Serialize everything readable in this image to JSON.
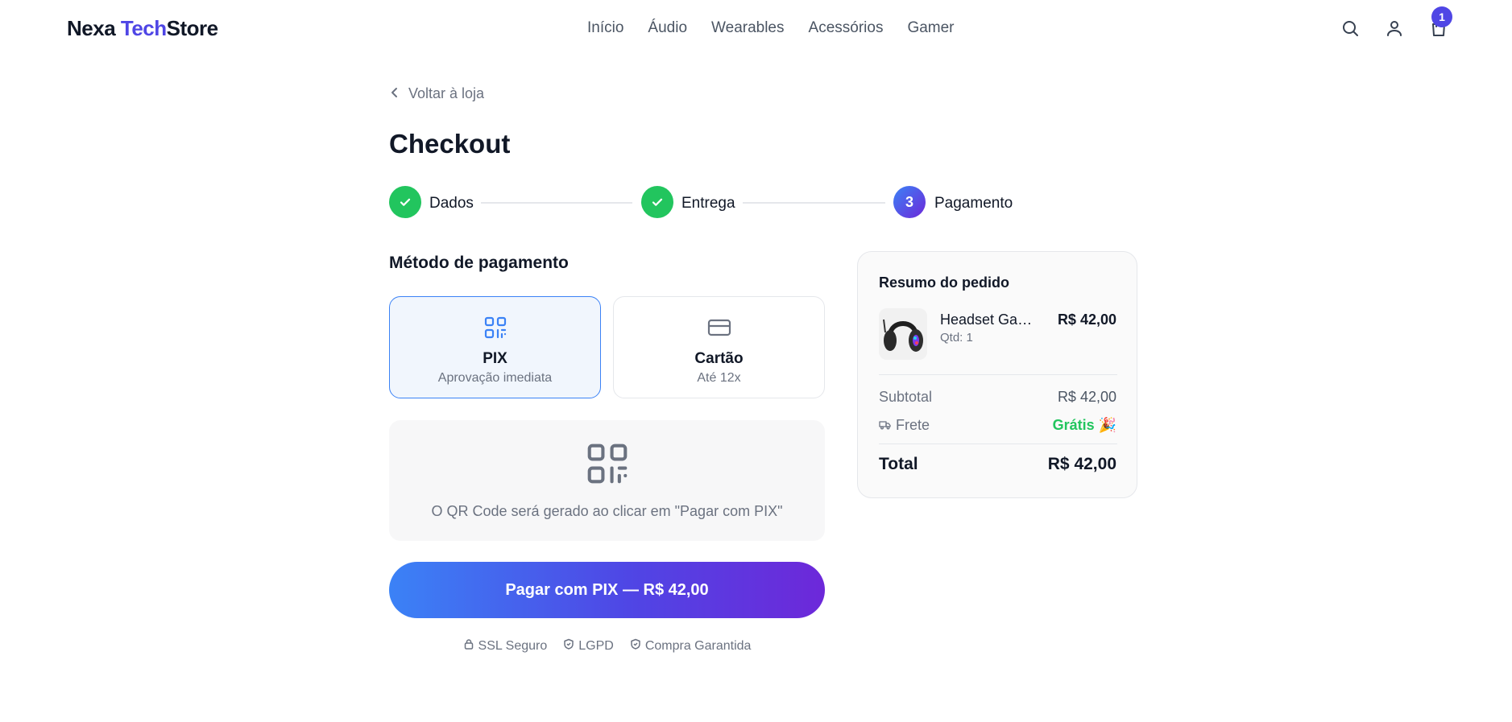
{
  "header": {
    "logo": {
      "part1": "Nexa ",
      "part2": "Tech",
      "part3": "Store"
    },
    "nav": [
      "Início",
      "Áudio",
      "Wearables",
      "Acessórios",
      "Gamer"
    ],
    "icons": [
      "search-icon",
      "user-icon",
      "cart-icon"
    ],
    "cart_count": "1"
  },
  "back_link": "Voltar à loja",
  "title": "Checkout",
  "steps": [
    {
      "label": "Dados",
      "status": "done"
    },
    {
      "label": "Entrega",
      "status": "done"
    },
    {
      "number": "3",
      "label": "Pagamento",
      "status": "active"
    }
  ],
  "payment": {
    "section_title": "Método de pagamento",
    "methods": [
      {
        "title": "PIX",
        "subtitle": "Aprovação imediata",
        "icon": "qr-code-icon",
        "selected": true
      },
      {
        "title": "Cartão",
        "subtitle": "Até 12x",
        "icon": "credit-card-icon",
        "selected": false
      }
    ],
    "qr_text": "O QR Code será gerado ao clicar em \"Pagar com PIX\"",
    "pay_button": "Pagar com PIX — R$ 42,00",
    "trust": [
      "SSL Seguro",
      "LGPD",
      "Compra Garantida"
    ]
  },
  "summary": {
    "title": "Resumo do pedido",
    "product": {
      "name": "Headset Gamer",
      "qty": "Qtd: 1",
      "price": "R$ 42,00"
    },
    "subtotal_label": "Subtotal",
    "subtotal_value": "R$ 42,00",
    "shipping_label": "Frete",
    "shipping_value": "Grátis 🎉",
    "total_label": "Total",
    "total_value": "R$ 42,00"
  },
  "colors": {
    "accent": "#4f46e5",
    "success": "#22c55e",
    "selected_border": "#3b82f6"
  }
}
